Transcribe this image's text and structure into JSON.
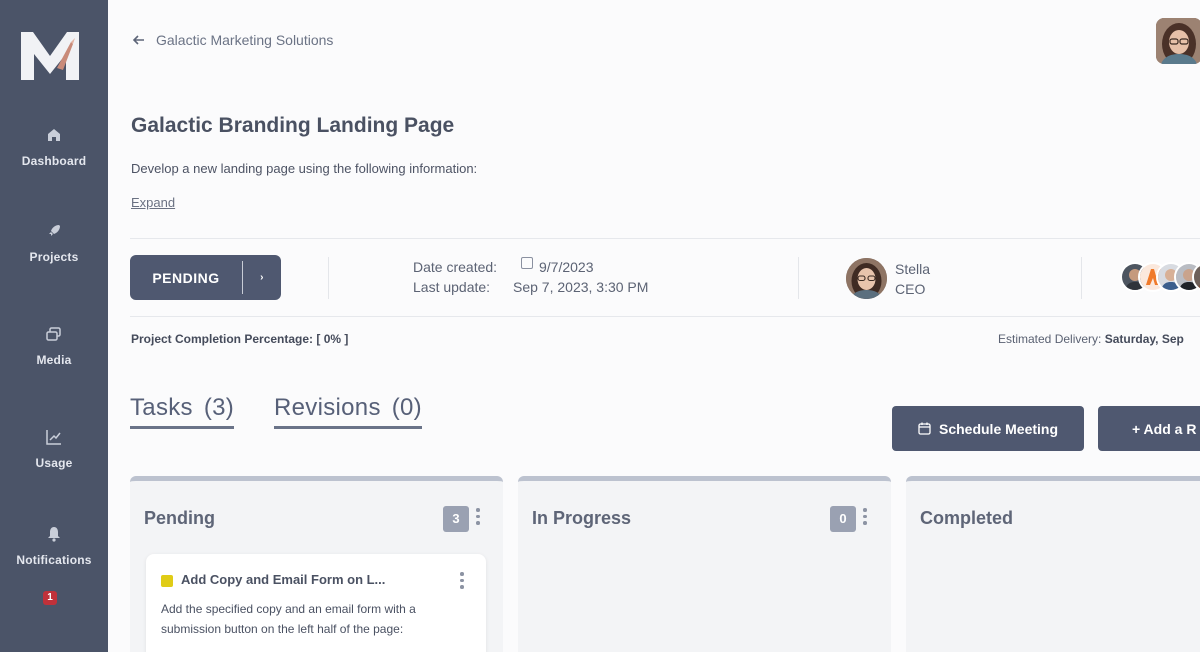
{
  "sidebar": {
    "logo_letter": "M",
    "items": [
      {
        "label": "Dashboard",
        "icon": "home-icon"
      },
      {
        "label": "Projects",
        "icon": "rocket-icon"
      },
      {
        "label": "Media",
        "icon": "media-icon"
      },
      {
        "label": "Usage",
        "icon": "chart-icon"
      },
      {
        "label": "Notifications",
        "icon": "bell-icon",
        "badge": "1"
      }
    ]
  },
  "header": {
    "back_label": "Galactic Marketing Solutions"
  },
  "project": {
    "title": "Galactic Branding Landing Page",
    "description": "Develop a new landing page using the following information:",
    "expand_label": "Expand",
    "status_label": "PENDING",
    "status_arrow": "›",
    "date_created_label": "Date created:",
    "date_created_value": "9/7/2023",
    "last_update_label": "Last update:",
    "last_update_value": "Sep 7, 2023, 3:30 PM",
    "owner_name": "Stella",
    "owner_role": "CEO",
    "completion_label": "Project Completion Percentage: [ 0% ]",
    "delivery_label": "Estimated Delivery:",
    "delivery_value": "Saturday, Sep"
  },
  "tabs": [
    {
      "label": "Tasks",
      "count": "(3)"
    },
    {
      "label": "Revisions",
      "count": "(0)"
    }
  ],
  "actions": {
    "schedule_label": "Schedule Meeting",
    "add_label": "+ Add a R"
  },
  "board": {
    "columns": [
      {
        "title": "Pending",
        "count": "3"
      },
      {
        "title": "In Progress",
        "count": "0"
      },
      {
        "title": "Completed",
        "count": ""
      }
    ],
    "cards": [
      {
        "title": "Add Copy and Email Form on L...",
        "description": "Add the specified copy and an email form with a submission button on the left half of the page:",
        "color": "#e0cc16"
      }
    ]
  },
  "colors": {
    "sidebar": "#4b5468",
    "primary_button": "#4f5870",
    "badge": "#c0313a"
  }
}
